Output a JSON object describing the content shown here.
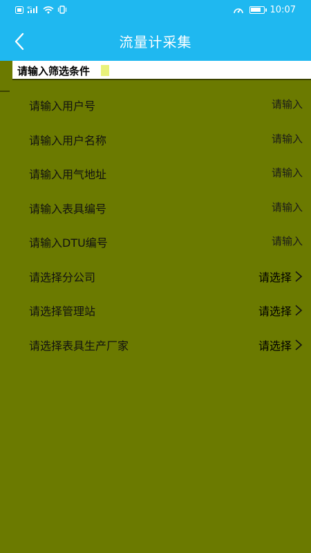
{
  "status_bar": {
    "left_icons": [
      "notification-icon",
      "4g-signal-icon",
      "wifi-icon",
      "vibrate-icon"
    ],
    "right_icons": [
      "speedometer-icon",
      "battery-icon"
    ],
    "time": "10:07",
    "battery_level": 0.85
  },
  "nav": {
    "back_icon": "chevron-left-icon",
    "title": "流量计采集"
  },
  "filter": {
    "header": "请输入筛选条件"
  },
  "rows": [
    {
      "label": "请输入用户号",
      "value": "请输入",
      "kind": "input"
    },
    {
      "label": "请输入用户名称",
      "value": "请输入",
      "kind": "input"
    },
    {
      "label": "请输入用气地址",
      "value": "请输入",
      "kind": "input"
    },
    {
      "label": "请输入表具编号",
      "value": "请输入",
      "kind": "input"
    },
    {
      "label": "请输入DTU编号",
      "value": "请输入",
      "kind": "input"
    },
    {
      "label": "请选择分公司",
      "value": "请选择",
      "kind": "select"
    },
    {
      "label": "请选择管理站",
      "value": "请选择",
      "kind": "select"
    },
    {
      "label": "请选择表具生产厂家",
      "value": "请选择",
      "kind": "select"
    }
  ],
  "colors": {
    "header": "#1fb8f0",
    "background": "#6b7a00"
  }
}
